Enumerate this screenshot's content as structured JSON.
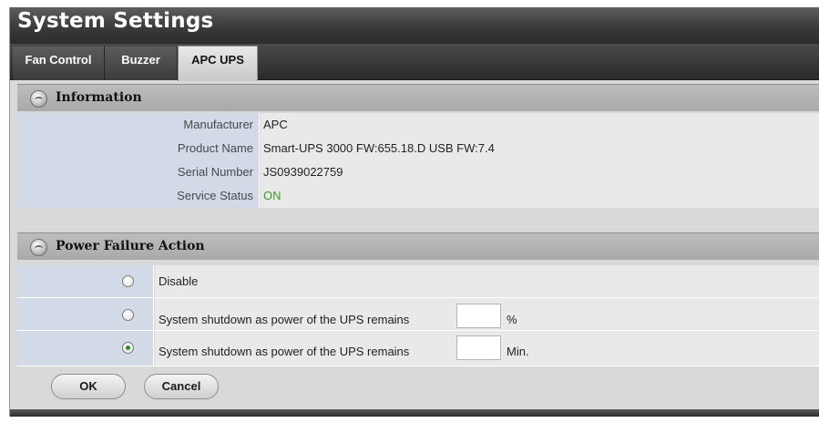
{
  "window": {
    "title": "System Settings"
  },
  "tabs": [
    {
      "label": "Fan Control",
      "active": false
    },
    {
      "label": "Buzzer",
      "active": false
    },
    {
      "label": "APC UPS",
      "active": true
    }
  ],
  "information": {
    "heading": "Information",
    "icon": "info-gear-icon",
    "rows": [
      {
        "label": "Manufacturer",
        "value": "APC"
      },
      {
        "label": "Product Name",
        "value": "Smart-UPS 3000 FW:655.18.D USB FW:7.4"
      },
      {
        "label": "Serial Number",
        "value": "JS0939022759"
      },
      {
        "label": "Service Status",
        "value": "ON"
      }
    ]
  },
  "power_failure": {
    "heading": "Power Failure Action",
    "icon": "power-gear-icon",
    "options": [
      {
        "label": "Disable",
        "checked": false
      },
      {
        "label": "System shutdown as power of the UPS remains",
        "value": "",
        "unit": "%",
        "checked": false
      },
      {
        "label": "System shutdown as power of the UPS remains",
        "value": "",
        "unit": "Min.",
        "checked": true
      }
    ]
  },
  "buttons": {
    "ok": "OK",
    "cancel": "Cancel"
  },
  "colors": {
    "status_on": "#3a9a25",
    "label_bg": "#d2dae8",
    "value_bg": "#e9e9e9",
    "titlebar": "#3a3a3a"
  }
}
